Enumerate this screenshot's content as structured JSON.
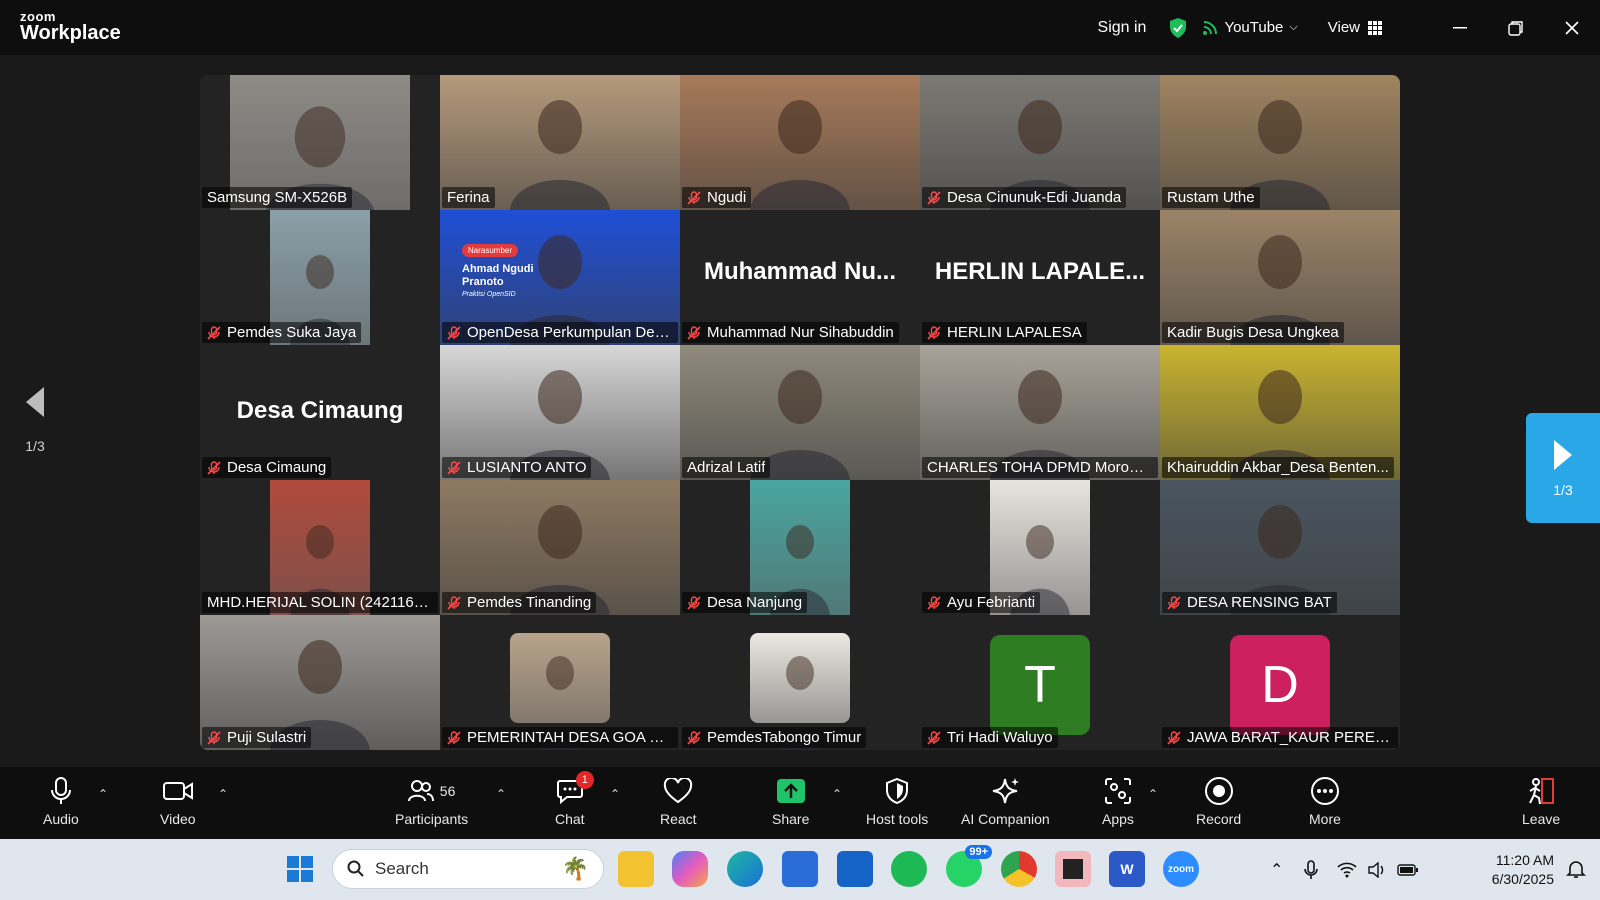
{
  "app": {
    "logo_small": "zoom",
    "logo_big": "Workplace"
  },
  "titlebar": {
    "sign_in": "Sign in",
    "stream_label": "YouTube",
    "view_label": "View"
  },
  "gallery": {
    "page_indicator_left": "1/3",
    "page_indicator_right": "1/3",
    "tiles": [
      {
        "name": "Samsung SM-X526B",
        "muted": false,
        "bg": "#8e8b86",
        "video": "narrow",
        "active": false
      },
      {
        "name": "Ferina",
        "muted": false,
        "bg": "#b59a7c",
        "video": "full",
        "active": true
      },
      {
        "name": "Ngudi",
        "muted": true,
        "bg": "#a87a5a",
        "video": "full",
        "active": false
      },
      {
        "name": "Desa Cinunuk-Edi Juanda",
        "muted": true,
        "bg": "#7c7a74",
        "video": "full",
        "active": false
      },
      {
        "name": "Rustam Uthe",
        "muted": false,
        "bg": "#a08460",
        "video": "full",
        "active": false
      },
      {
        "name": "Pemdes Suka Jaya",
        "muted": true,
        "bg": "#8aa0a8",
        "video": "portrait",
        "active": false
      },
      {
        "name": "OpenDesa Perkumpulan Des...",
        "muted": true,
        "bg": "#1f4fd6",
        "video": "full",
        "active": false,
        "overlay_tag": "Narasumber",
        "overlay_title": "Ahmad Ngudi Pranoto",
        "overlay_sub": "Praktisi OpenSID"
      },
      {
        "name": "Muhammad Nur Sihabuddin",
        "muted": true,
        "bg": "",
        "video": "none",
        "active": false,
        "big_name": "Muhammad  Nu..."
      },
      {
        "name": "HERLIN LAPALESA",
        "muted": true,
        "bg": "",
        "video": "none",
        "active": false,
        "big_name": "HERLIN  LAPALE..."
      },
      {
        "name": "Kadir Bugis Desa Ungkea",
        "muted": false,
        "bg": "#9c8468",
        "video": "full",
        "active": false
      },
      {
        "name": "Desa Cimaung",
        "muted": true,
        "bg": "",
        "video": "none",
        "active": false,
        "big_name": "Desa Cimaung"
      },
      {
        "name": "LUSIANTO ANTO",
        "muted": true,
        "bg": "#d8d8d8",
        "video": "full",
        "active": false
      },
      {
        "name": "Adrizal Latif",
        "muted": false,
        "bg": "#8f8a7c",
        "video": "full",
        "active": false
      },
      {
        "name": "CHARLES TOHA DPMD Morowa...",
        "muted": false,
        "bg": "#a9a49a",
        "video": "full",
        "active": false
      },
      {
        "name": "Khairuddin Akbar_Desa Benten...",
        "muted": false,
        "bg": "#c9b430",
        "video": "full",
        "active": false
      },
      {
        "name": "MHD.HERIJAL SOLIN (24211641)",
        "muted": false,
        "bg": "#b04a3c",
        "video": "portrait",
        "active": false
      },
      {
        "name": "Pemdes Tinanding",
        "muted": true,
        "bg": "#8e7a62",
        "video": "full",
        "active": false
      },
      {
        "name": "Desa Nanjung",
        "muted": true,
        "bg": "#4aa5a0",
        "video": "portrait",
        "active": false
      },
      {
        "name": "Ayu Febrianti",
        "muted": true,
        "bg": "#e8e4df",
        "video": "portrait",
        "active": false
      },
      {
        "name": "DESA RENSING BAT",
        "muted": true,
        "bg": "#4a5560",
        "video": "full",
        "active": false
      },
      {
        "name": "Puji Sulastri",
        "muted": true,
        "bg": "#9d9a96",
        "video": "full",
        "active": false
      },
      {
        "name": "PEMERINTAH DESA GOA BO...",
        "muted": true,
        "bg": "#b9a48c",
        "video": "photo",
        "active": false
      },
      {
        "name": "PemdesTabongo Timur",
        "muted": true,
        "bg": "#ece8e2",
        "video": "photo",
        "active": false
      },
      {
        "name": "Tri Hadi Waluyo",
        "muted": true,
        "bg": "#2f7d22",
        "video": "avatar",
        "active": false,
        "initial": "T"
      },
      {
        "name": "JAWA BARAT_KAUR PERENC...",
        "muted": true,
        "bg": "#cc1f5e",
        "video": "avatar",
        "active": false,
        "initial": "D"
      }
    ]
  },
  "toolbar": {
    "audio": "Audio",
    "video": "Video",
    "participants": "Participants",
    "participant_count": "56",
    "chat": "Chat",
    "chat_badge": "1",
    "react": "React",
    "share": "Share",
    "host_tools": "Host tools",
    "ai_companion": "AI Companion",
    "apps": "Apps",
    "record": "Record",
    "more": "More",
    "leave": "Leave"
  },
  "taskbar": {
    "search_placeholder": "Search",
    "whatsapp_badge": "99+",
    "zoom_label": "zoom",
    "time": "11:20 AM",
    "date": "6/30/2025"
  },
  "colors": {
    "active_speaker": "#2ecc71",
    "share_green": "#1fc46a",
    "next_page": "#2aa7e6"
  }
}
